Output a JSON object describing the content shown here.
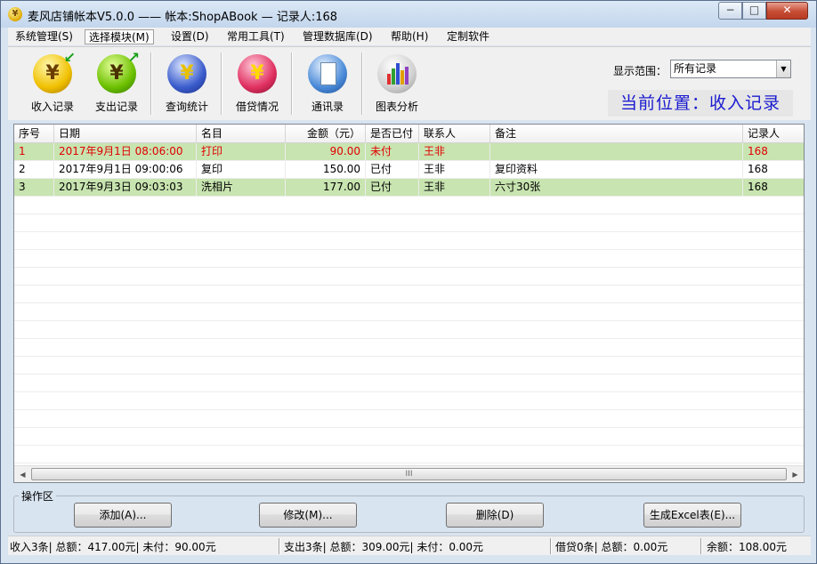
{
  "window": {
    "title": "麦风店铺帐本V5.0.0  ——  帐本:ShopABook — 记录人:168",
    "app_icon": "¥",
    "controls": {
      "minimize": "−",
      "maximize": "□",
      "close": "✕"
    }
  },
  "menu": [
    {
      "label": "系统管理(S)"
    },
    {
      "label": "选择模块(M)"
    },
    {
      "label": "设置(D)"
    },
    {
      "label": "常用工具(T)"
    },
    {
      "label": "管理数据库(D)"
    },
    {
      "label": "帮助(H)"
    },
    {
      "label": "定制软件"
    }
  ],
  "toolbar": {
    "tools": [
      {
        "label": "收入记录",
        "icon": "yuan-income-icon",
        "glyph": "¥"
      },
      {
        "label": "支出记录",
        "icon": "yuan-expense-icon",
        "glyph": "¥"
      },
      {
        "label": "查询统计",
        "icon": "search-stats-icon",
        "glyph": "¥"
      },
      {
        "label": "借贷情况",
        "icon": "loan-icon",
        "glyph": "¥"
      },
      {
        "label": "通讯录",
        "icon": "contacts-icon",
        "glyph": ""
      },
      {
        "label": "图表分析",
        "icon": "chart-icon",
        "glyph": ""
      }
    ],
    "range_label": "显示范围：",
    "range_value": "所有记录",
    "location": "当前位置：收入记录"
  },
  "table": {
    "columns": [
      "序号",
      "日期",
      "名目",
      "金额（元）",
      "是否已付",
      "联系人",
      "备注",
      "记录人"
    ],
    "rows": [
      {
        "no": "1",
        "date": "2017年9月1日  08:06:00",
        "item": "打印",
        "amount": "90.00",
        "paid": "未付",
        "contact": "王非",
        "note": "",
        "recorder": "168"
      },
      {
        "no": "2",
        "date": "2017年9月1日  09:00:06",
        "item": "复印",
        "amount": "150.00",
        "paid": "已付",
        "contact": "王非",
        "note": "复印资料",
        "recorder": "168"
      },
      {
        "no": "3",
        "date": "2017年9月3日  09:03:03",
        "item": "洗相片",
        "amount": "177.00",
        "paid": "已付",
        "contact": "王非",
        "note": "六寸30张",
        "recorder": "168"
      }
    ],
    "scroll_grip": "III"
  },
  "operations": {
    "group_label": "操作区",
    "buttons": [
      "添加(A)...",
      "修改(M)...",
      "删除(D)",
      "生成Excel表(E)..."
    ]
  },
  "status": {
    "income": "收入3条| 总额：417.00元| 未付：90.00元",
    "expense": "支出3条| 总额：309.00元| 未付：0.00元",
    "loan": "借贷0条| 总额：0.00元",
    "balance": "余额：108.00元"
  },
  "colors": {
    "unpaid_text": "#e00000",
    "alt_row": "#c8e4b0",
    "location_text": "#1a1ad0"
  }
}
